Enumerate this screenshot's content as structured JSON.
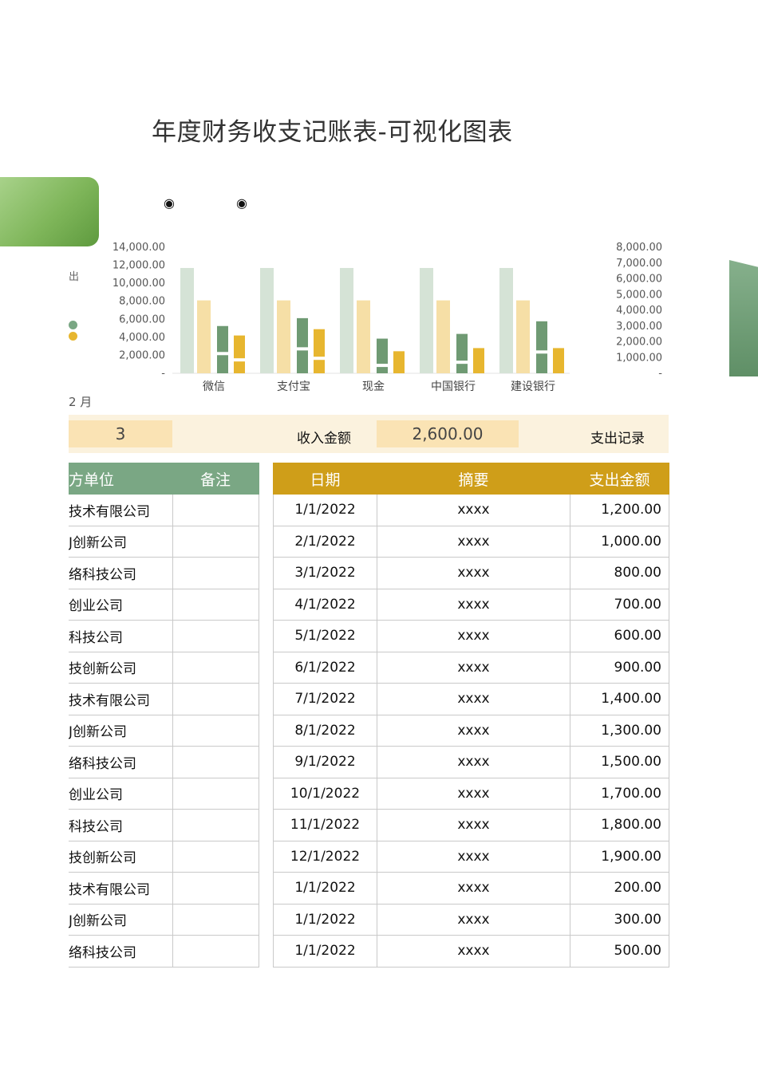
{
  "title": "年度财务收支记账表-可视化图表",
  "radio_markers": [
    "◉",
    "◉"
  ],
  "legend_fragment": "出",
  "month_fragment": "2 月",
  "colors": {
    "green": "#7aa784",
    "gold": "#cf9e19",
    "light_green": "#d5e3d6",
    "light_gold": "#f6dfa6",
    "mid_green": "#6f9a73",
    "mid_gold": "#e7b62f"
  },
  "chart_data": {
    "type": "bar",
    "categories": [
      "微信",
      "支付宝",
      "现金",
      "中国银行",
      "建设银行"
    ],
    "y_left": {
      "ticks": [
        "-",
        "2,000.00",
        "4,000.00",
        "6,000.00",
        "8,000.00",
        "10,000.00",
        "12,000.00",
        "14,000.00"
      ],
      "max": 14000
    },
    "y_right": {
      "ticks": [
        "-",
        "1,000.00",
        "2,000.00",
        "3,000.00",
        "4,000.00",
        "5,000.00",
        "6,000.00",
        "7,000.00",
        "8,000.00"
      ],
      "max": 8000
    },
    "series": [
      {
        "axis": "left",
        "color": "#d5e3d6",
        "values": [
          11700,
          11700,
          11700,
          11700,
          11700
        ]
      },
      {
        "axis": "left",
        "color": "#f6dfa6",
        "values": [
          8100,
          8100,
          8100,
          8100,
          8100
        ]
      },
      {
        "axis": "right",
        "color": "#6f9a73",
        "values": [
          3000,
          3500,
          2200,
          2500,
          3300
        ],
        "gap": [
          1150,
          1450,
          400,
          600,
          1250
        ]
      },
      {
        "axis": "right",
        "color": "#e7b62f",
        "values": [
          2400,
          2800,
          1400,
          1600,
          1600
        ],
        "gap": [
          750,
          850,
          0,
          0,
          0
        ]
      }
    ]
  },
  "summary": {
    "left_value": "3",
    "income_label": "收入金额",
    "income_value": "2,600.00",
    "expense_label": "支出记录"
  },
  "left_table": {
    "headers": [
      "方单位",
      "备注"
    ],
    "rows": [
      "技术有限公司",
      "J创新公司",
      "络科技公司",
      "创业公司",
      "科技公司",
      "技创新公司",
      "技术有限公司",
      "J创新公司",
      "络科技公司",
      "创业公司",
      "科技公司",
      "技创新公司",
      "技术有限公司",
      "J创新公司",
      "络科技公司"
    ]
  },
  "right_table": {
    "headers": [
      "日期",
      "摘要",
      "支出金额"
    ],
    "rows": [
      [
        "1/1/2022",
        "xxxx",
        "1,200.00"
      ],
      [
        "2/1/2022",
        "xxxx",
        "1,000.00"
      ],
      [
        "3/1/2022",
        "xxxx",
        "800.00"
      ],
      [
        "4/1/2022",
        "xxxx",
        "700.00"
      ],
      [
        "5/1/2022",
        "xxxx",
        "600.00"
      ],
      [
        "6/1/2022",
        "xxxx",
        "900.00"
      ],
      [
        "7/1/2022",
        "xxxx",
        "1,400.00"
      ],
      [
        "8/1/2022",
        "xxxx",
        "1,300.00"
      ],
      [
        "9/1/2022",
        "xxxx",
        "1,500.00"
      ],
      [
        "10/1/2022",
        "xxxx",
        "1,700.00"
      ],
      [
        "11/1/2022",
        "xxxx",
        "1,800.00"
      ],
      [
        "12/1/2022",
        "xxxx",
        "1,900.00"
      ],
      [
        "1/1/2022",
        "xxxx",
        "200.00"
      ],
      [
        "1/1/2022",
        "xxxx",
        "300.00"
      ],
      [
        "1/1/2022",
        "xxxx",
        "500.00"
      ]
    ]
  }
}
